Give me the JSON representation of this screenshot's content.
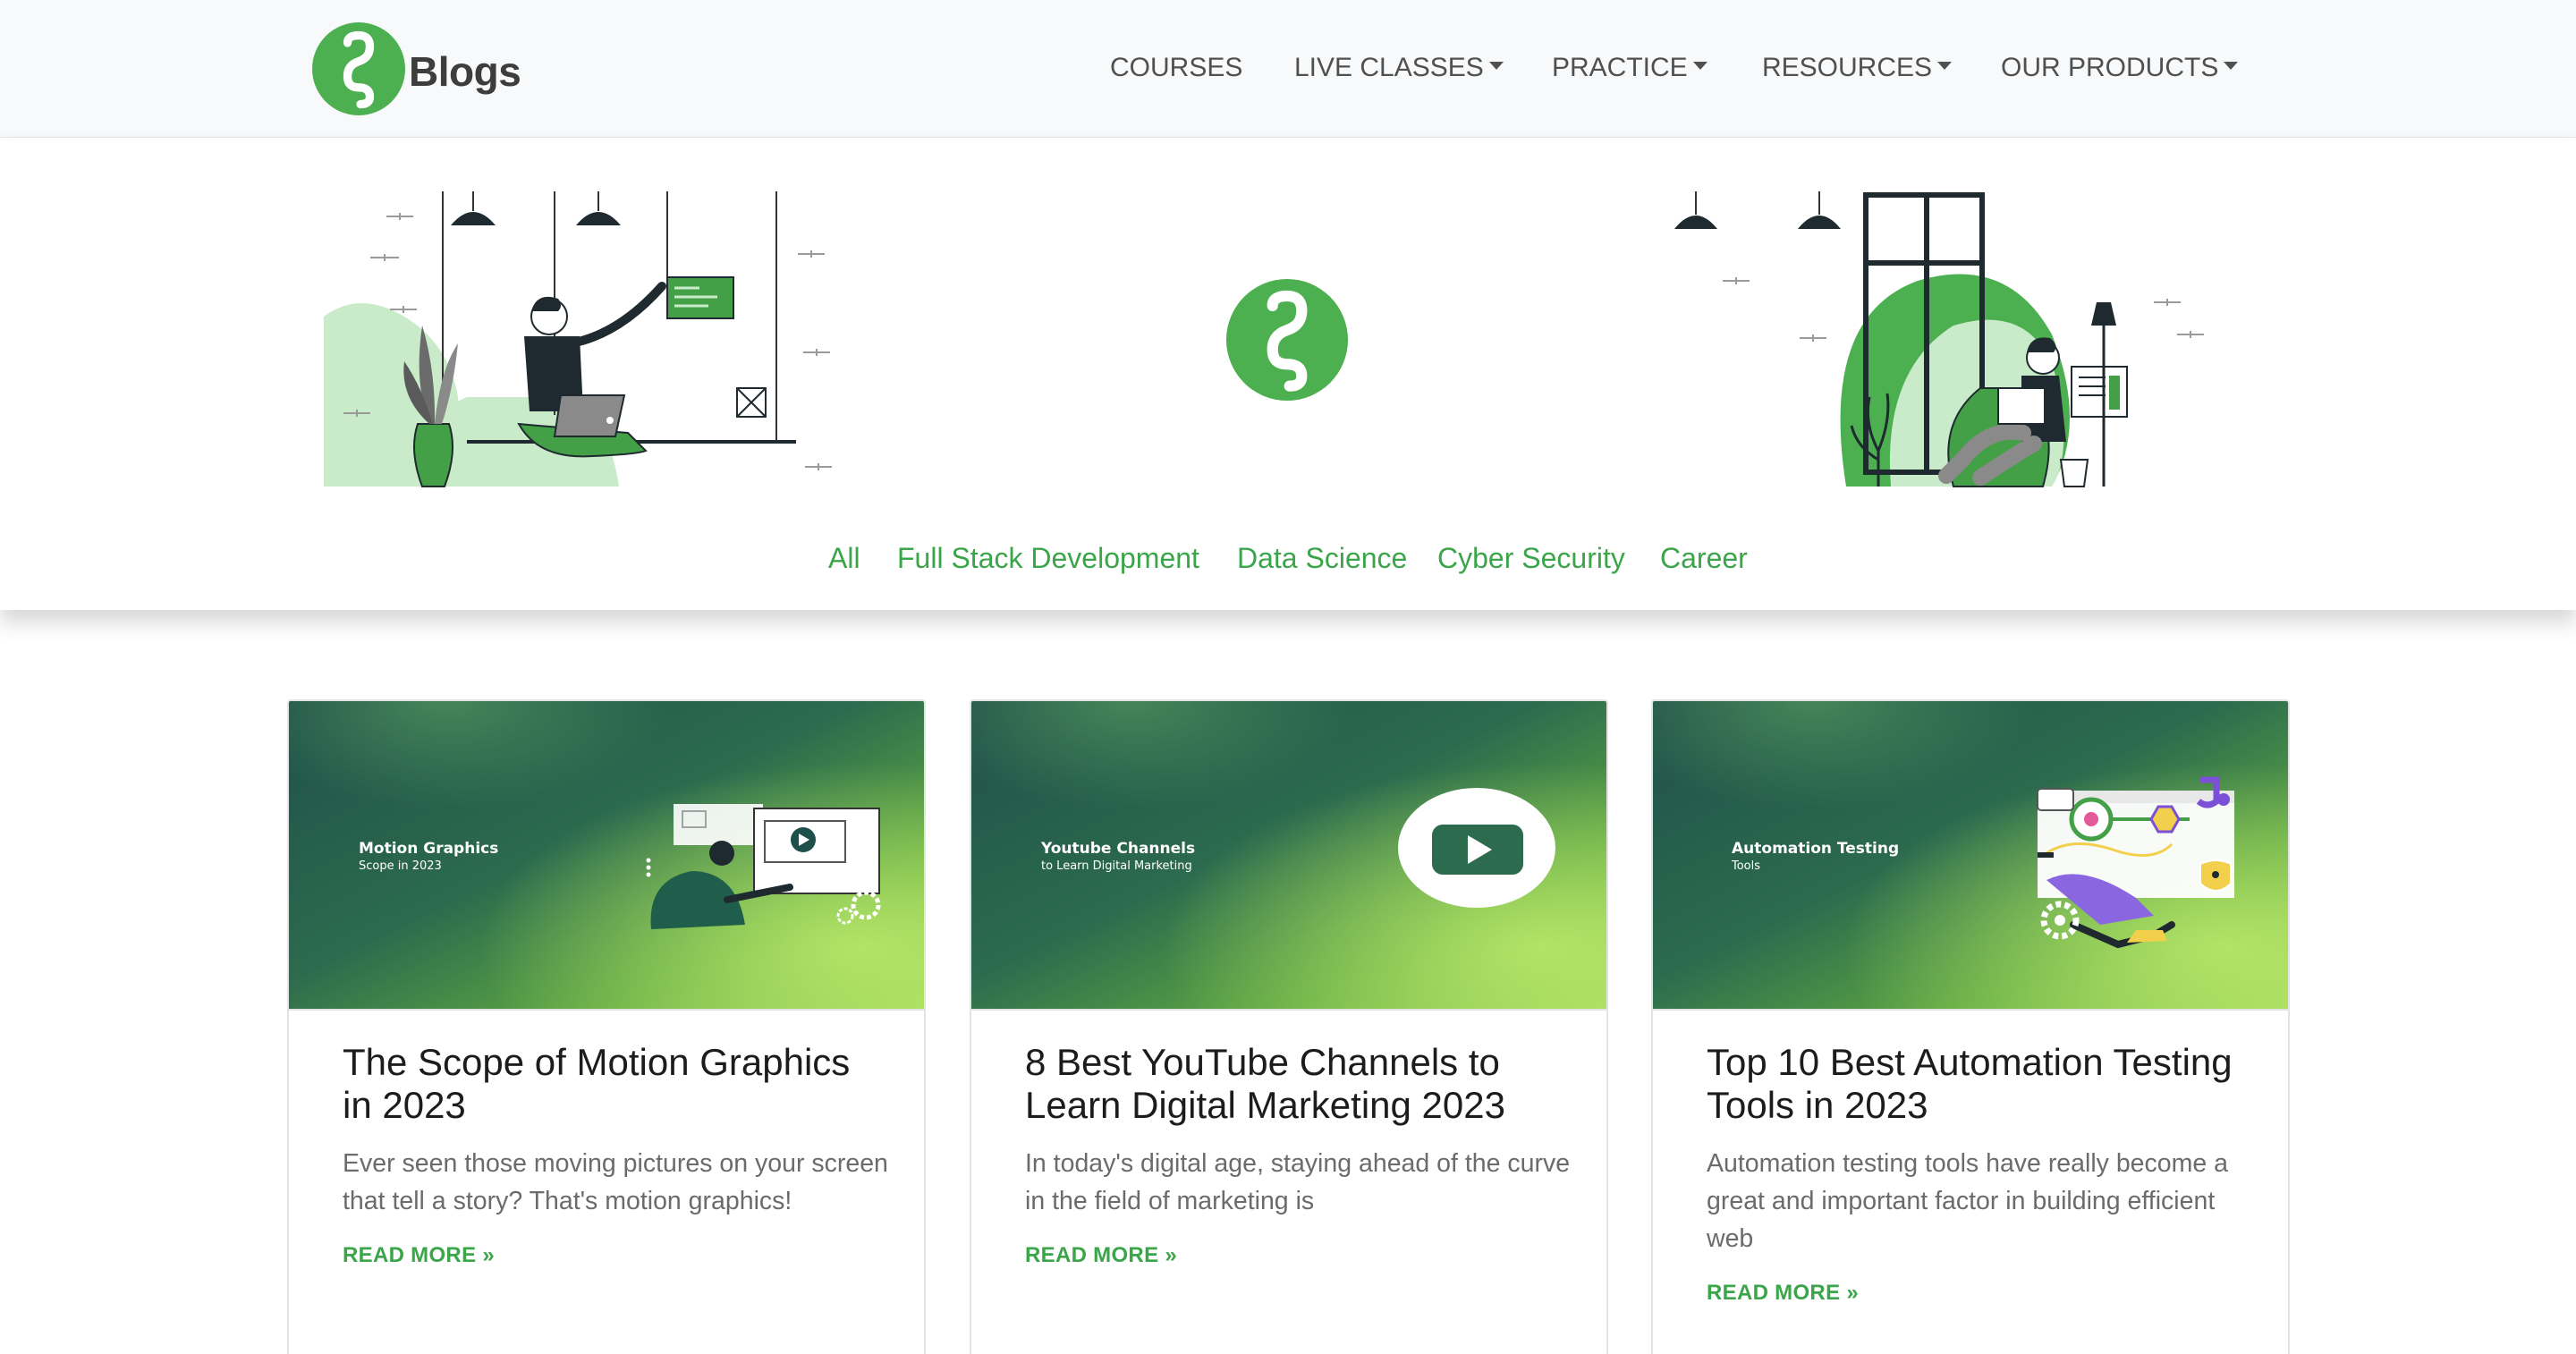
{
  "brand": {
    "name": "Blogs",
    "logo_icon": "geekster-logo-icon",
    "accent_color": "#4caf50"
  },
  "nav": {
    "items": [
      {
        "label": "COURSES",
        "has_dropdown": false
      },
      {
        "label": "LIVE CLASSES",
        "has_dropdown": true
      },
      {
        "label": "PRACTICE",
        "has_dropdown": true
      },
      {
        "label": "RESOURCES",
        "has_dropdown": true
      },
      {
        "label": "OUR PRODUCTS",
        "has_dropdown": true
      }
    ]
  },
  "hero": {
    "left_illustration": "person-working-on-laptop-illustration",
    "center_icon": "geekster-logo-icon",
    "right_illustration": "person-reading-in-chair-illustration"
  },
  "filters": {
    "items": [
      "All",
      "Full Stack Development",
      "Data Science",
      "Cyber Security",
      "Career"
    ],
    "color": "#3ba54a"
  },
  "cards": [
    {
      "image_title": "Motion Graphics",
      "image_subtitle": "Scope in 2023",
      "image_icon": "motion-graphics-illustration",
      "title": "The Scope of Motion Graphics in 2023",
      "excerpt": "Ever seen those moving pictures on your screen that tell a story? That's motion graphics!",
      "read_more": "READ MORE »"
    },
    {
      "image_title": "Youtube Channels",
      "image_subtitle": "to Learn Digital Marketing",
      "image_icon": "youtube-play-icon",
      "title": "8 Best YouTube Channels to Learn Digital Marketing 2023",
      "excerpt": "In today's digital age, staying ahead of the curve in the field of marketing is",
      "read_more": "READ MORE »"
    },
    {
      "image_title": "Automation Testing",
      "image_subtitle": "Tools",
      "image_icon": "automation-testing-illustration",
      "title": "Top 10 Best Automation Testing Tools in 2023",
      "excerpt": "Automation testing tools have really become a great and important factor in building efficient web",
      "read_more": "READ MORE »"
    }
  ]
}
